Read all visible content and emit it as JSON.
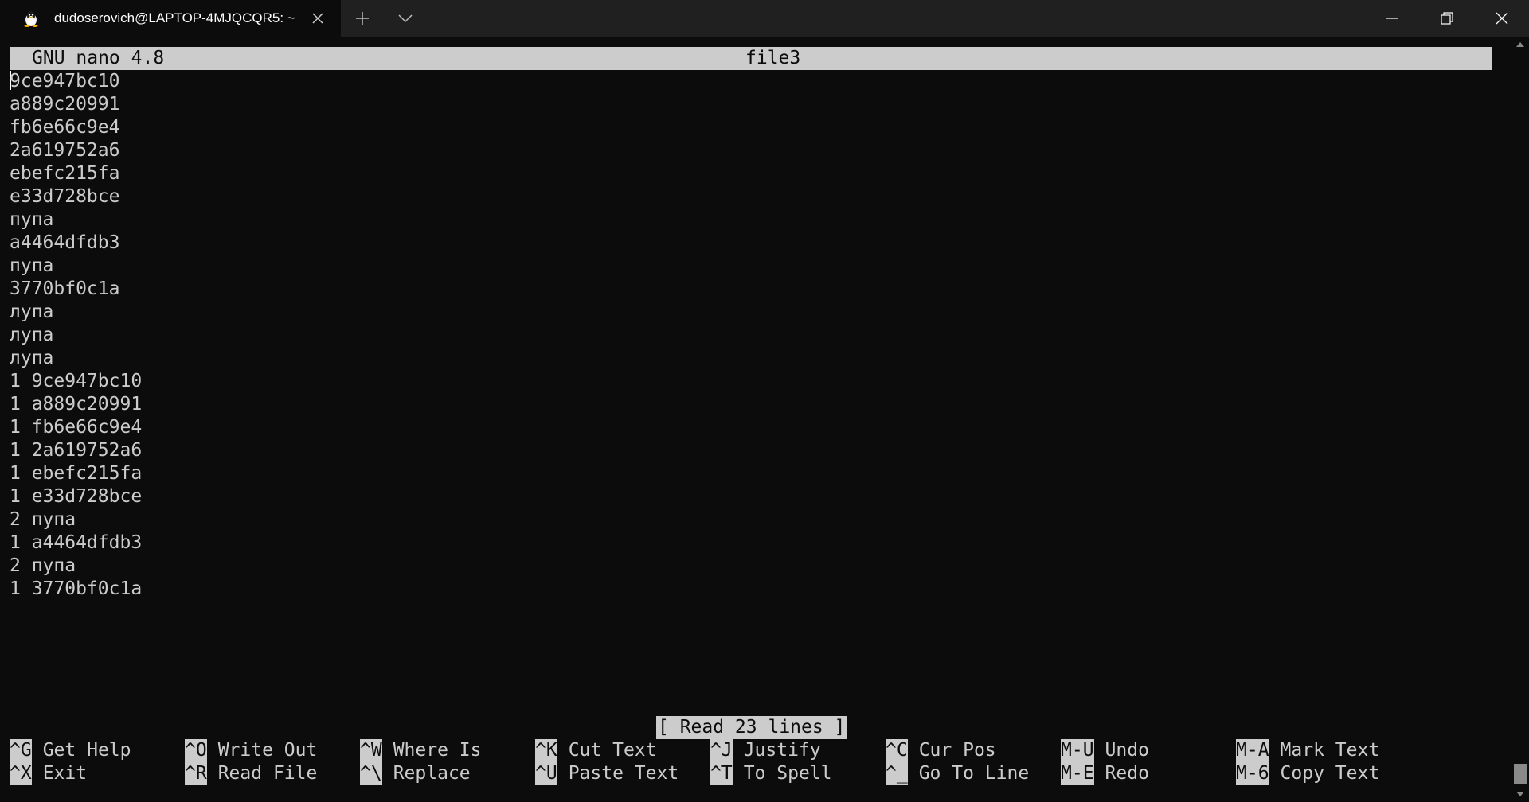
{
  "window": {
    "tab_title": "dudoserovich@LAPTOP-4MJQCQR5: ~",
    "tab_icon": "linux-penguin-icon"
  },
  "colors": {
    "background": "#0c0c0c",
    "foreground": "#cccccc",
    "titlebar": "#202020"
  },
  "nano": {
    "app": "GNU nano 4.8",
    "filename": "file3",
    "lines": [
      "9ce947bc10",
      "a889c20991",
      "fb6e66c9e4",
      "2a619752a6",
      "ebefc215fa",
      "e33d728bce",
      "пупа",
      "a4464dfdb3",
      "пупа",
      "3770bf0c1a",
      "лупа",
      "лупа",
      "лупа",
      "1 9ce947bc10",
      "1 a889c20991",
      "1 fb6e66c9e4",
      "1 2a619752a6",
      "1 ebefc215fa",
      "1 e33d728bce",
      "2 пупа",
      "1 a4464dfdb3",
      "2 пупа",
      "1 3770bf0c1a"
    ],
    "status": "[ Read 23 lines ]",
    "shortcuts": [
      {
        "key": "^G",
        "label": "Get Help"
      },
      {
        "key": "^X",
        "label": "Exit"
      },
      {
        "key": "^O",
        "label": "Write Out"
      },
      {
        "key": "^R",
        "label": "Read File"
      },
      {
        "key": "^W",
        "label": "Where Is"
      },
      {
        "key": "^\\",
        "label": "Replace"
      },
      {
        "key": "^K",
        "label": "Cut Text"
      },
      {
        "key": "^U",
        "label": "Paste Text"
      },
      {
        "key": "^J",
        "label": "Justify"
      },
      {
        "key": "^T",
        "label": "To Spell"
      },
      {
        "key": "^C",
        "label": "Cur Pos"
      },
      {
        "key": "^_",
        "label": "Go To Line"
      },
      {
        "key": "M-U",
        "label": "Undo"
      },
      {
        "key": "M-E",
        "label": "Redo"
      },
      {
        "key": "M-A",
        "label": "Mark Text"
      },
      {
        "key": "M-6",
        "label": "Copy Text"
      }
    ]
  }
}
